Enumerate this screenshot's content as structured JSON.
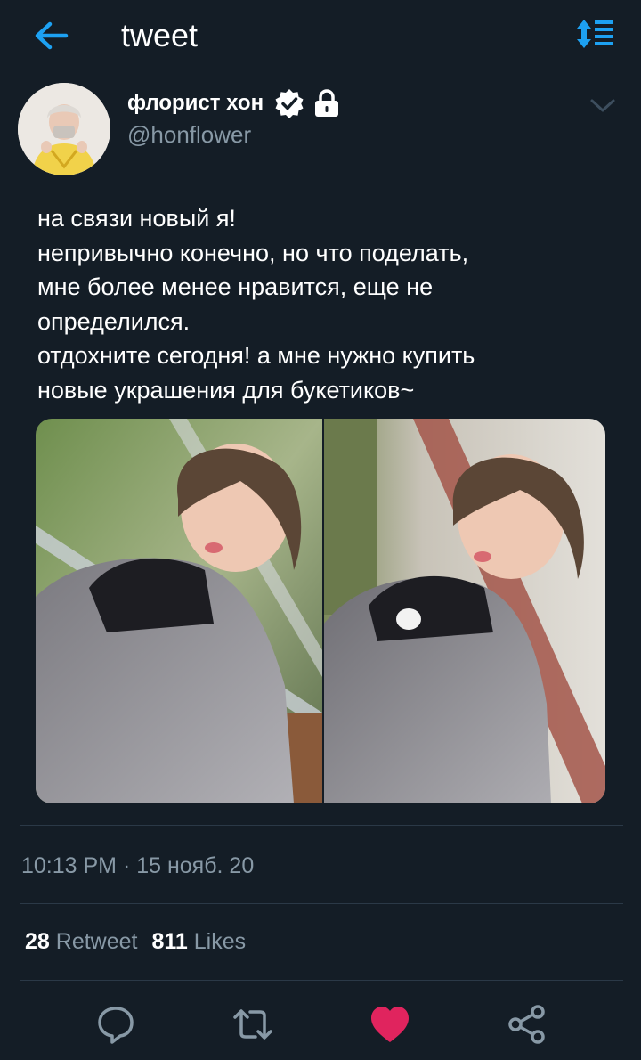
{
  "header": {
    "title": "tweet",
    "back_icon": "arrow-left-icon",
    "sort_icon": "sort-list-icon"
  },
  "author": {
    "name": "флорист хон",
    "handle": "@honflower",
    "verified": true,
    "protected": true
  },
  "tweet": {
    "lines": [
      "на связи новый я!",
      "непривычно конечно, но что поделать,",
      "мне более менее нравится, еще не",
      "определился.",
      "отдохните сегодня! а мне нужно купить",
      "новые украшения для букетиков~"
    ],
    "timestamp": "10:13 PM · 15 нояб. 20",
    "photo_count": 2
  },
  "stats": {
    "retweets": "28",
    "retweet_label": "Retweet",
    "likes": "811",
    "likes_label": "Likes"
  },
  "actions": [
    {
      "name": "reply",
      "icon": "speech-bubble-icon"
    },
    {
      "name": "retweet",
      "icon": "retweet-icon"
    },
    {
      "name": "like",
      "icon": "heart-icon",
      "active": true
    },
    {
      "name": "share",
      "icon": "share-icon"
    }
  ],
  "colors": {
    "background": "#141d26",
    "accent": "#1da1f2",
    "muted": "#8899a6",
    "like": "#e0245e",
    "divider": "#2b3947"
  }
}
